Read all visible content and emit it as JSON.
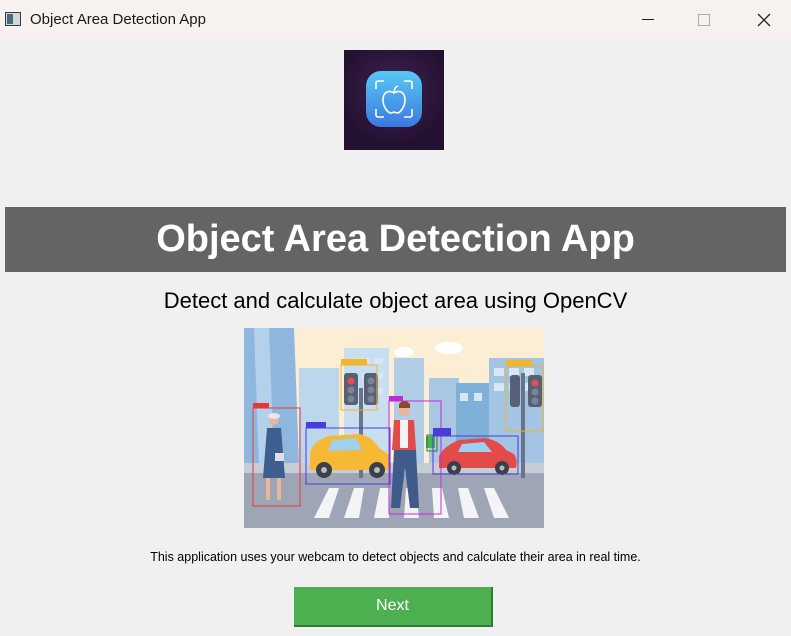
{
  "window": {
    "title": "Object Area Detection App",
    "icon": "app-window-icon",
    "controls": [
      "minimize-icon",
      "maximize-icon",
      "close-icon"
    ]
  },
  "logo": {
    "icon": "apple-scan-icon"
  },
  "banner": {
    "title": "Object Area Detection App"
  },
  "subtitle": "Detect and calculate object area using OpenCV",
  "illustration": {
    "icon": "street-detection-illustration"
  },
  "description": "This application uses your webcam to detect objects and calculate their area in real time.",
  "next_button": {
    "label": "Next",
    "color": "#4caf50"
  },
  "colors": {
    "banner_bg": "#646464",
    "window_bg": "#f0f0f0",
    "titlebar_bg": "#f7f2ef"
  }
}
